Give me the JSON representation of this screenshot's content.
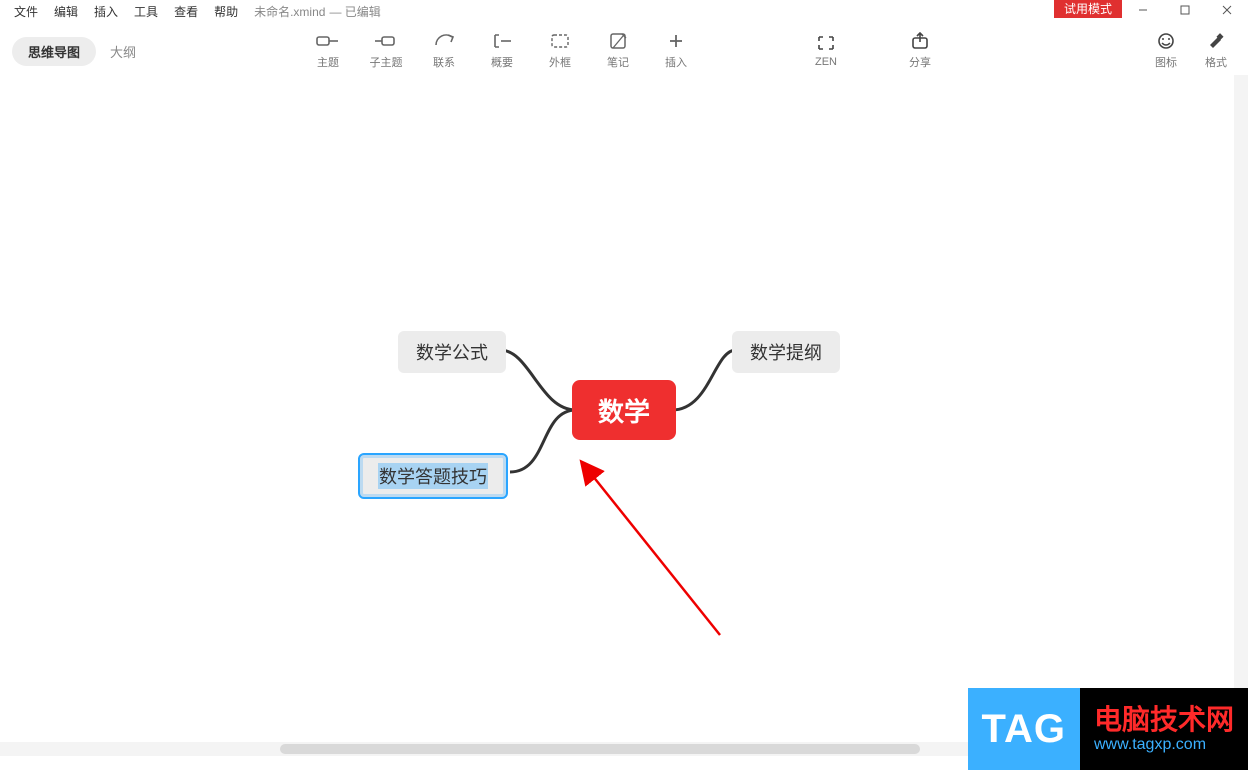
{
  "menu": {
    "file": "文件",
    "edit": "编辑",
    "insert": "插入",
    "tools": "工具",
    "view": "查看",
    "help": "帮助"
  },
  "document": {
    "title": "未命名.xmind",
    "status": "— 已编辑"
  },
  "trial_badge": "试用模式",
  "window_buttons": {
    "min": "minimize",
    "max": "maximize",
    "close": "close"
  },
  "view_tabs": {
    "mindmap": "思维导图",
    "outline": "大纲"
  },
  "toolbar": {
    "topic": "主题",
    "subtopic": "子主题",
    "relationship": "联系",
    "summary": "概要",
    "boundary": "外框",
    "notes": "笔记",
    "insert": "插入",
    "zen": "ZEN",
    "share": "分享",
    "icons": "图标",
    "format": "格式"
  },
  "mindmap": {
    "central": "数学",
    "nodes": {
      "formula": "数学公式",
      "outline": "数学提纲",
      "tips": "数学答题技巧"
    },
    "selected": "tips"
  },
  "watermark": {
    "tag": "TAG",
    "line1": "电脑技术网",
    "line2": "www.tagxp.com"
  }
}
